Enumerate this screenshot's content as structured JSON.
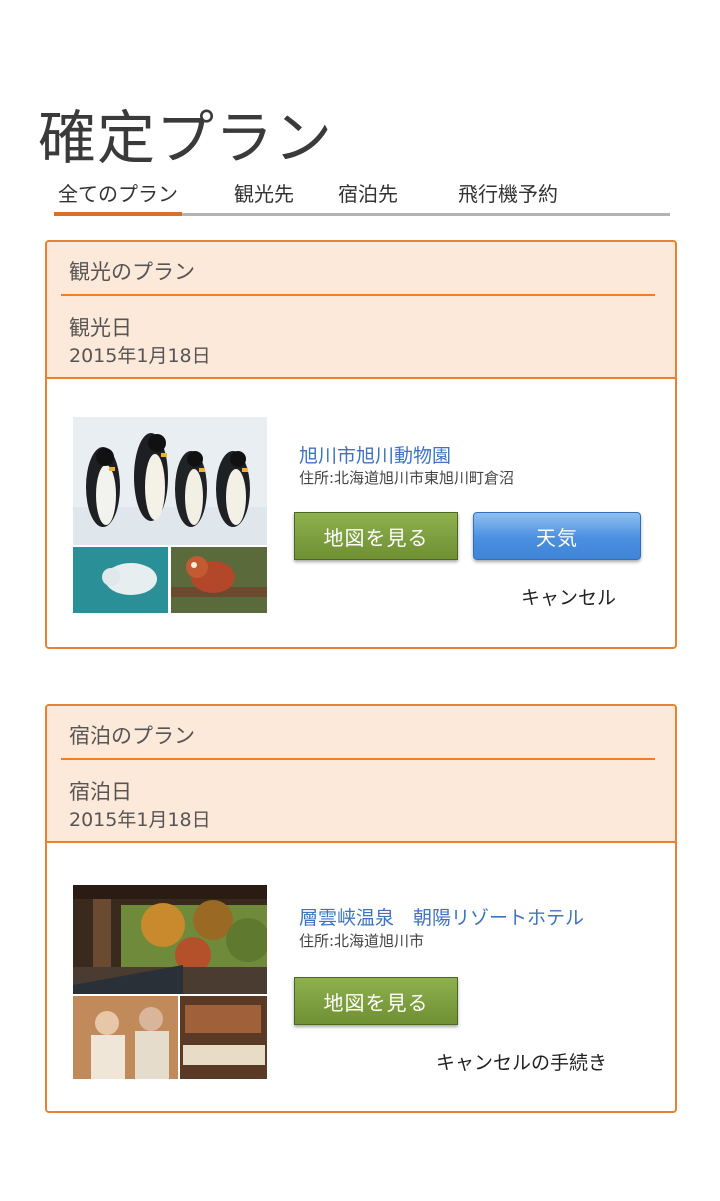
{
  "page": {
    "title": "確定プラン"
  },
  "tabs": [
    {
      "label": "全てのプラン",
      "active": true
    },
    {
      "label": "観光先",
      "active": false
    },
    {
      "label": "宿泊先",
      "active": false
    },
    {
      "label": "飛行機予約",
      "active": false
    }
  ],
  "sightseeing_card": {
    "kicker": "観光のプラン",
    "date_label": "観光日",
    "date": "2015年1月18日",
    "place_name": "旭川市旭川動物園",
    "address": "住所:北海道旭川市東旭川町倉沼",
    "map_button": "地図を見る",
    "weather_button": "天気",
    "cancel_link": "キャンセル"
  },
  "lodging_card": {
    "kicker": "宿泊のプラン",
    "date_label": "宿泊日",
    "date": "2015年1月18日",
    "place_name": "層雲峡温泉　朝陽リゾートホテル",
    "address": "住所:北海道旭川市",
    "map_button": "地図を見る",
    "cancel_link": "キャンセルの手続き"
  },
  "colors": {
    "accent_orange": "#e8822e",
    "header_fill": "#fde9da",
    "link_blue": "#3d74c2",
    "button_green": "#7a9a3c",
    "button_blue": "#4a8fe0"
  }
}
